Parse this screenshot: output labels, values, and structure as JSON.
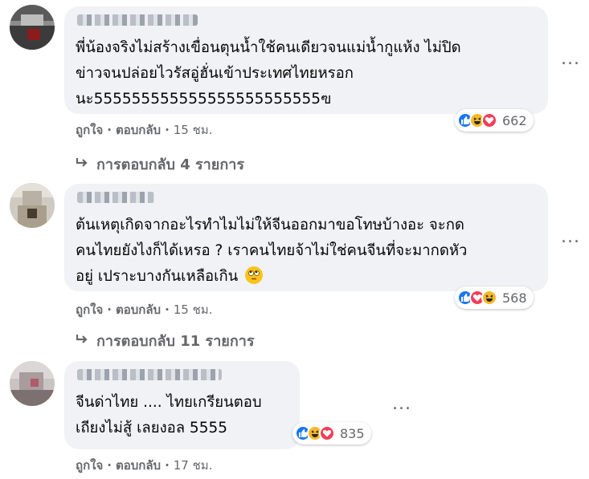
{
  "colors": {
    "bubble": "#f0f2f5",
    "meta_text": "#65676b",
    "like": "#1877f2",
    "haha": "#f7b928",
    "love": "#f33e58"
  },
  "comments": [
    {
      "lines": [
        "พี่น้องจริงไม่สร้างเขื่อนตุนน้ำใช้คนเดียวจนแม่น้ำกูแห้ง ไม่ปิด",
        "ข่าวจนปล่อยไวรัสอู่ฮั่นเข้าประเทศไทยหรอก",
        "นะ555555555555555555555555ฃ"
      ],
      "reactions": [
        "like",
        "haha",
        "love"
      ],
      "reaction_count": "662",
      "like_label": "ถูกใจ",
      "reply_label": "ตอบกลับ",
      "time": "15 ชม.",
      "more_label": "...",
      "replies_label": "การตอบกลับ 4 รายการ"
    },
    {
      "lines": [
        "ต้นเหตุเกิดจากอะไรทำไมไม่ให้จีนออกมาขอโทษบ้างอะ จะกด",
        "คนไทยยังไงก็ได้เหรอ ? เราคนไทยจ้าไม่ใช่คนจีนที่จะมากดหัว",
        "อยู่ เปราะบางกันเหลือเกิน"
      ],
      "emoji": "rolling-eyes-emoji",
      "reactions": [
        "like",
        "love",
        "haha"
      ],
      "reaction_count": "568",
      "like_label": "ถูกใจ",
      "reply_label": "ตอบกลับ",
      "time": "15 ชม.",
      "more_label": "...",
      "replies_label": "การตอบกลับ 11 รายการ"
    },
    {
      "lines": [
        "จีนด่าไทย .... ไทยเกรียนตอบ",
        "เถียงไม่สู้ เลยงอล 5555"
      ],
      "reactions": [
        "like",
        "haha",
        "love"
      ],
      "reaction_count": "835",
      "like_label": "ถูกใจ",
      "reply_label": "ตอบกลับ",
      "time": "17 ชม.",
      "more_label": "..."
    }
  ]
}
